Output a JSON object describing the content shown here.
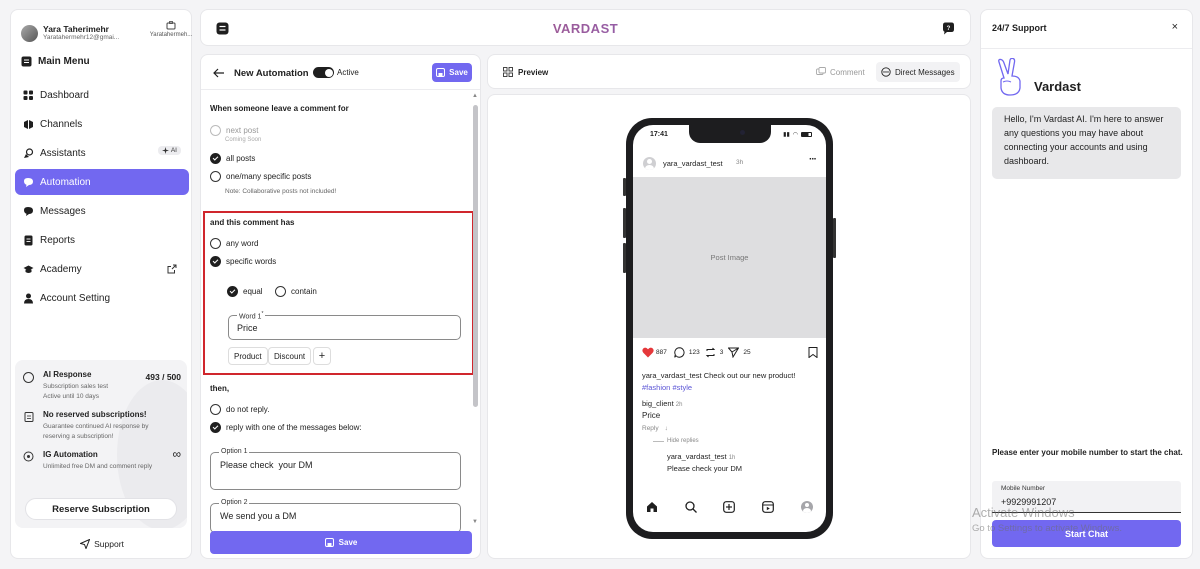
{
  "user": {
    "name": "Yara Taherimehr",
    "email": "Yaratahermehr12@gmai...",
    "workspace": "Yaratahermeh..."
  },
  "sidebar": {
    "title": "Main Menu",
    "items": [
      {
        "label": "Dashboard",
        "icon": "dashboard-icon"
      },
      {
        "label": "Channels",
        "icon": "channels-icon"
      },
      {
        "label": "Assistants",
        "icon": "assistants-icon",
        "badge": "AI"
      },
      {
        "label": "Automation",
        "icon": "automation-icon",
        "active": true
      },
      {
        "label": "Messages",
        "icon": "messages-icon"
      },
      {
        "label": "Reports",
        "icon": "reports-icon"
      },
      {
        "label": "Academy",
        "icon": "academy-icon",
        "external": true
      },
      {
        "label": "Account Setting",
        "icon": "account-icon"
      }
    ],
    "subscriptions": {
      "ai": {
        "title": "AI Response",
        "count": "493 / 500",
        "line1": "Subscription sales test",
        "line2": "Active until 10 days"
      },
      "reserved": {
        "title": "No reserved subscriptions!",
        "desc": "Guarantee continued AI response by reserving a subscription!"
      },
      "ig": {
        "title": "IG Automation",
        "desc": "Unlimited free DM and comment reply"
      },
      "reserve_button": "Reserve Subscription"
    },
    "support": "Support"
  },
  "header": {
    "brand": "VARDAST"
  },
  "editor": {
    "title": "New Automation",
    "toggle_label": "Active",
    "save": "Save",
    "trigger_title": "When someone leave a comment for",
    "next_post": "next post",
    "coming_soon": "Coming Soon",
    "all_posts": "all posts",
    "specific_posts": "one/many specific posts",
    "collab_note": "Note: Collaborative posts not included!",
    "comment_has": "and this comment has",
    "any_word": "any word",
    "specific_words": "specific words",
    "equal": "equal",
    "contain": "contain",
    "word_label": "Word 1",
    "word_required": "*",
    "word_value": "Price",
    "chips": [
      "Product",
      "Discount"
    ],
    "then": "then,",
    "no_reply": "do not reply.",
    "reply_messages": "reply with one of the messages below:",
    "option1_label": "Option 1",
    "option1_value": "Please check  your DM",
    "option2_label": "Option 2",
    "option2_value": "We send you a DM",
    "bottom_save": "Save"
  },
  "preview": {
    "title": "Preview",
    "tab_comment": "Comment",
    "tab_dm": "Direct Messages",
    "phone": {
      "time": "17:41",
      "username": "yara_vardast_test",
      "post_age": "3h",
      "post_image": "Post Image",
      "likes": "887",
      "comments": "123",
      "reposts": "3",
      "shares": "25",
      "caption_user": "yara_vardast_test",
      "caption_text": "Check out our new product!",
      "hashtags": "#fashion #style",
      "comment_user": "big_client",
      "comment_age": "2h",
      "comment_text": "Price",
      "reply": "Reply",
      "hide_replies": "Hide replies",
      "reply_user": "yara_vardast_test",
      "reply_age": "1h",
      "reply_text": "Please check your DM"
    }
  },
  "support_panel": {
    "title": "24/7 Support",
    "brand": "Vardast",
    "message": "Hello, I'm Vardast AI. I'm here to answer any questions you may have about connecting your accounts and using dashboard.",
    "prompt": "Please enter your mobile number to start the chat.",
    "mobile_label": "Mobile Number",
    "mobile_value": "+9929991207",
    "start": "Start Chat"
  },
  "watermark": {
    "line1": "Activate Windows",
    "line2": "Go to Settings to activate Windows."
  },
  "colors": {
    "accent": "#7268f0",
    "highlight_border": "#d0262d",
    "like": "#e5383b",
    "hashtag": "#5b55d6"
  }
}
